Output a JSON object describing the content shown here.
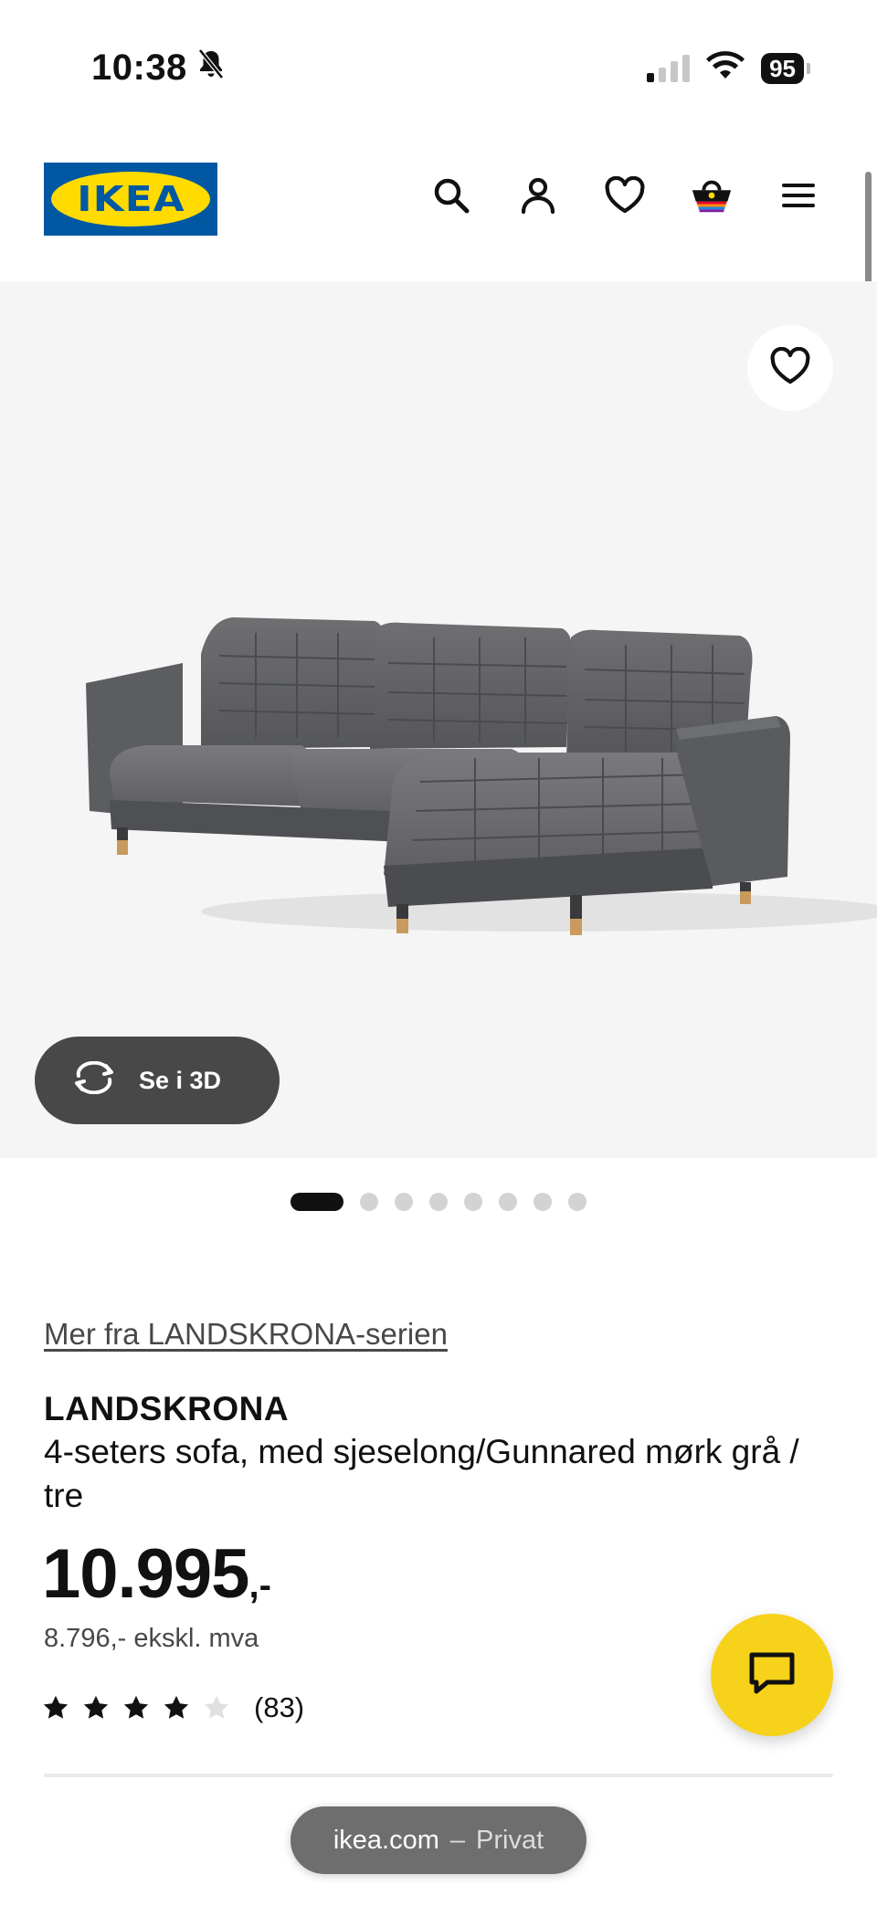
{
  "status_bar": {
    "time": "10:38",
    "battery": "95"
  },
  "header": {
    "logo_text": "IKEA"
  },
  "hero": {
    "view_3d_label": "Se i 3D",
    "carousel": {
      "total": 8,
      "active": 0
    }
  },
  "product": {
    "series_link": "Mer fra LANDSKRONA-serien",
    "name": "LANDSKRONA",
    "description": "4-seters sofa, med sjeselong/Gunnared mørk grå / tre",
    "price_main": "10.995",
    "price_suffix": ",-",
    "price_ex_vat": "8.796,- ekskl. mva",
    "rating": 4,
    "rating_max": 5,
    "review_count": "(83)"
  },
  "browser": {
    "domain": "ikea.com",
    "separator": "–",
    "mode": "Privat"
  },
  "colors": {
    "ikea_blue": "#0058a3",
    "ikea_yellow": "#ffdb00",
    "chat_yellow": "#f6d21b"
  }
}
